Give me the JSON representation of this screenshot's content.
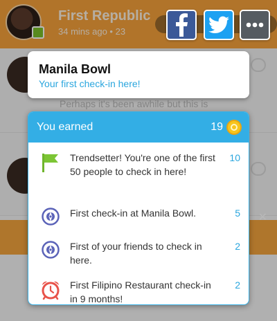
{
  "background": {
    "header_title": "First Republic",
    "header_subtitle": "34 mins ago • 23",
    "feed_text": "Perhaps it's been awhile but this is"
  },
  "share": {
    "facebook_icon": "facebook-icon",
    "twitter_icon": "twitter-icon",
    "more_icon": "more-dots-icon"
  },
  "venue": {
    "name": "Manila Bowl",
    "subtitle": "Your first check-in here!"
  },
  "earned": {
    "title": "You earned",
    "total": "19",
    "coin_icon": "coin-icon",
    "items": [
      {
        "icon": "green-flag-icon",
        "text": "Trendsetter! You're one of the first 50 people to check in here!",
        "points": "10"
      },
      {
        "icon": "compass-badge-icon",
        "text": "First check-in at Manila Bowl.",
        "points": "5"
      },
      {
        "icon": "compass-badge-icon",
        "text": "First of your friends to check in here.",
        "points": "2"
      },
      {
        "icon": "alarm-clock-icon",
        "text": "First Filipino Restaurant check-in in 9 months!",
        "points": "2"
      }
    ]
  },
  "colors": {
    "accent_blue": "#33aee5",
    "orange": "#f6a13b",
    "facebook": "#3b5998",
    "twitter": "#1da1f2"
  }
}
